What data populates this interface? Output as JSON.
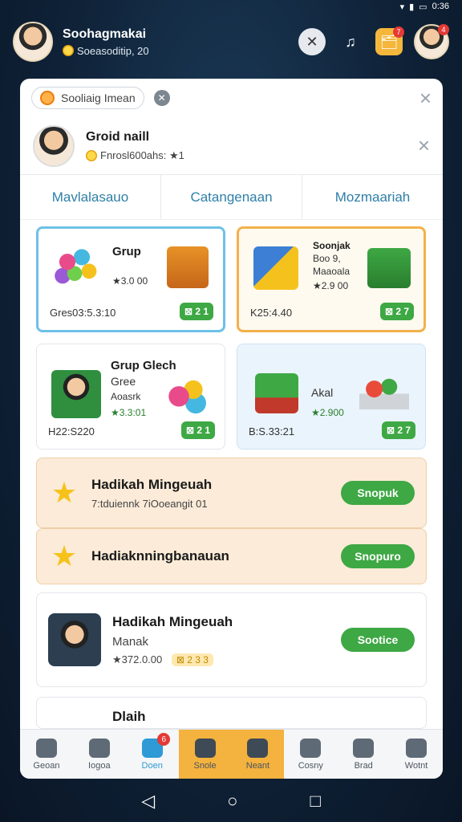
{
  "status": {
    "time": "0:36",
    "icons": [
      "wifi-icon",
      "signal-icon",
      "battery-icon"
    ]
  },
  "header": {
    "name": "Soohagmakai",
    "sub": "Soeasoditip, 20",
    "badge_count": "7",
    "profile_badge": "4"
  },
  "panel": {
    "search_label": "Sooliaig Imean",
    "profile_name": "Groid naill",
    "profile_sub": "Fnrosl600ahs: ★1",
    "tabs": [
      "Mavlalasauo",
      "Catangenaan",
      "Mozmaariah"
    ],
    "cards": [
      {
        "title": "Grup",
        "rating": "★3.0 00",
        "price": "Gres03:5.3:10",
        "buy": "⊠ 2 1"
      },
      {
        "title": "Soonjak",
        "sub1": "Boo 9,",
        "sub2": "Maaoala",
        "rating": "★2.9 00",
        "price": "K25:4.40",
        "buy": "⊠ 2 7"
      },
      {
        "title": "Grup Glech",
        "sub1": "Gree",
        "sub2": "Aoasrk",
        "rating": "★3.3:01",
        "price": "H22:S220",
        "buy": "⊠ 2 1"
      },
      {
        "title": "Akal",
        "rating": "★2.900",
        "price": "B:S.33:21",
        "buy": "⊠ 2 7"
      }
    ],
    "rows": [
      {
        "title": "Hadikah Mingeuah",
        "sub": "7:tduiennk 7iOoeangit 01",
        "cta": "Snopuk"
      },
      {
        "title": "Hadiaknningbanauan",
        "cta": "Snopuro"
      },
      {
        "title": "Hadikah Mingeuah",
        "sub": "Manak",
        "rating": "★372.0.00",
        "badge": "⊠ 2 3 3",
        "cta": "Sootice"
      }
    ],
    "partial_row_title": "Dlaih",
    "nav": [
      {
        "label": "Geoan",
        "icon": "home-icon"
      },
      {
        "label": "Iogoa",
        "icon": "search-icon"
      },
      {
        "label": "Doen",
        "icon": "store-icon",
        "badge": "6"
      },
      {
        "label": "Snole",
        "icon": "share-icon"
      },
      {
        "label": "Neant",
        "icon": "inbox-icon"
      },
      {
        "label": "Cosny",
        "icon": "doc-icon"
      },
      {
        "label": "Brad",
        "icon": "gear-icon"
      },
      {
        "label": "Wotnt",
        "icon": "user-icon"
      }
    ]
  }
}
